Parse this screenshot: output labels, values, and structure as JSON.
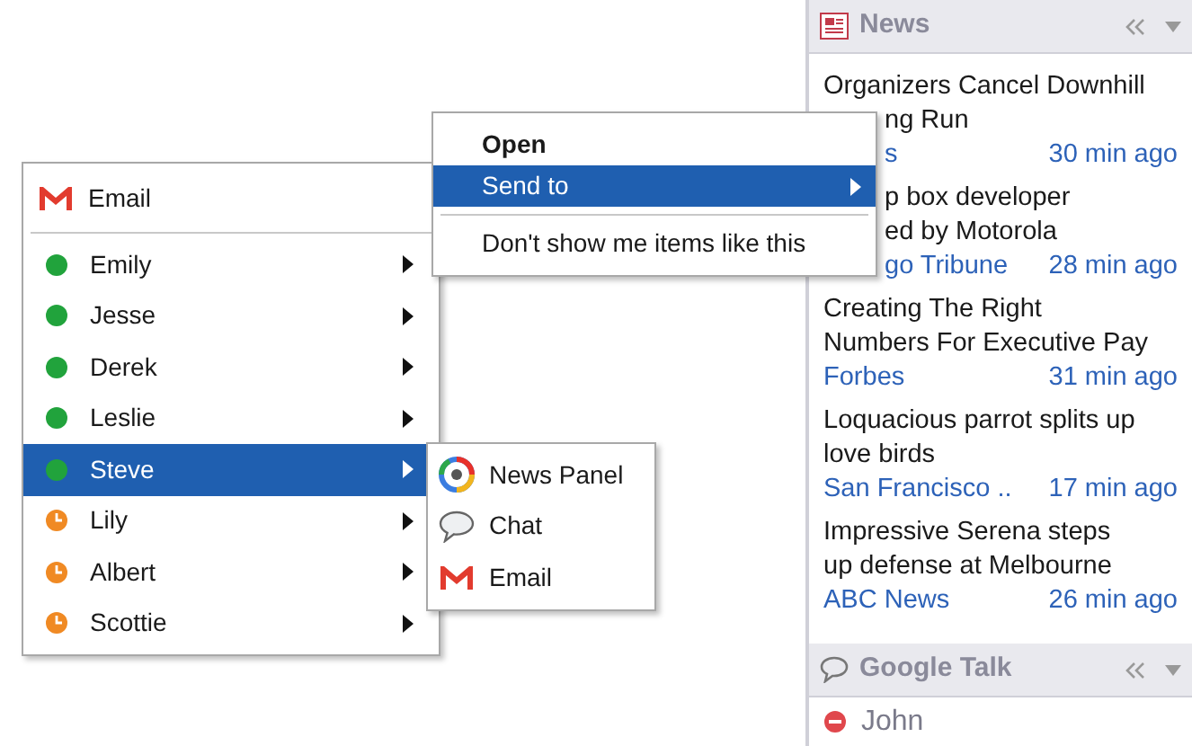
{
  "contact_menu": {
    "header_item": {
      "label": "Email"
    },
    "contacts": [
      {
        "name": "Emily",
        "kind": "available",
        "selected": false
      },
      {
        "name": "Jesse",
        "kind": "available",
        "selected": false
      },
      {
        "name": "Derek",
        "kind": "available",
        "selected": false
      },
      {
        "name": "Leslie",
        "kind": "available",
        "selected": false
      },
      {
        "name": "Steve",
        "kind": "available",
        "selected": true
      },
      {
        "name": "Lily",
        "kind": "idle",
        "selected": false
      },
      {
        "name": "Albert",
        "kind": "idle",
        "selected": false
      },
      {
        "name": "Scottie",
        "kind": "idle",
        "selected": false
      }
    ]
  },
  "send_submenu": [
    {
      "label": "News Panel",
      "kind": "news"
    },
    {
      "label": "Chat",
      "kind": "chat"
    },
    {
      "label": "Email",
      "kind": "email"
    }
  ],
  "item_menu": [
    {
      "label": "Open",
      "kind": "default",
      "selected": false
    },
    {
      "label": "Send to",
      "kind": "submenu",
      "selected": true
    },
    {
      "label": "Don't show me items like this",
      "kind": "plain",
      "selected": false
    }
  ],
  "news_panel": {
    "title": "News",
    "items": [
      {
        "lines": [
          {
            "text": "Organizers Cancel Downhill",
            "cut": false
          },
          {
            "text": "ng Run",
            "cut": true
          }
        ],
        "source": {
          "text": "s",
          "cut": true
        },
        "time": "30 min ago"
      },
      {
        "lines": [
          {
            "text": "p box developer",
            "cut": true
          },
          {
            "text": "ed by Motorola",
            "cut": true
          }
        ],
        "source": {
          "text": "go Tribune",
          "cut": true
        },
        "time": "28 min ago"
      },
      {
        "lines": [
          {
            "text": "Creating The Right",
            "cut": false
          },
          {
            "text": "Numbers For Executive Pay",
            "cut": false
          }
        ],
        "source": {
          "text": "Forbes",
          "cut": false
        },
        "time": "31 min ago"
      },
      {
        "lines": [
          {
            "text": "Loquacious parrot splits up",
            "cut": false
          },
          {
            "text": "love birds",
            "cut": false
          }
        ],
        "source": {
          "text": "San Francisco ..",
          "cut": false
        },
        "time": "17 min ago"
      },
      {
        "lines": [
          {
            "text": "Impressive Serena steps",
            "cut": false
          },
          {
            "text": "up defense at Melbourne",
            "cut": false
          }
        ],
        "source": {
          "text": "ABC News",
          "cut": false
        },
        "time": "26 min ago"
      }
    ]
  },
  "talk_panel": {
    "title": "Google Talk",
    "contacts": [
      {
        "name": "John",
        "kind": "busy"
      }
    ]
  }
}
